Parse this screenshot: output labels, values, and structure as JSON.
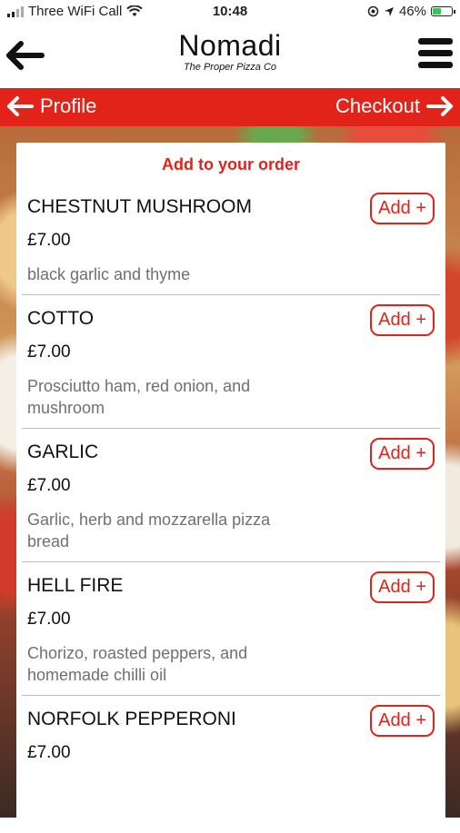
{
  "status": {
    "carrier": "Three WiFi Call",
    "time": "10:48",
    "battery": "46%",
    "battery_level": 0.46
  },
  "header": {
    "brand": "Nomadi",
    "tagline": "The Proper Pizza Co"
  },
  "nav": {
    "back_label": "Profile",
    "forward_label": "Checkout"
  },
  "menu": {
    "title": "Add to your order",
    "add_label": "Add +",
    "items": [
      {
        "name": "CHESTNUT MUSHROOM",
        "price": "£7.00",
        "description": "black garlic and thyme"
      },
      {
        "name": "COTTO",
        "price": "£7.00",
        "description": "Prosciutto ham, red onion, and mushroom"
      },
      {
        "name": "GARLIC",
        "price": "£7.00",
        "description": "Garlic, herb and mozzarella pizza bread"
      },
      {
        "name": "HELL FIRE",
        "price": "£7.00",
        "description": "Chorizo, roasted peppers, and homemade chilli oil"
      },
      {
        "name": "NORFOLK PEPPERONI",
        "price": "£7.00",
        "description": ""
      }
    ]
  },
  "colors": {
    "accent": "#e2231a",
    "text": "#111111",
    "muted": "#707070"
  },
  "icons": [
    "wifi-icon",
    "location-icon",
    "arrow-icon",
    "battery-icon",
    "back-arrow-icon",
    "menu-icon",
    "arrow-left-icon",
    "arrow-right-icon"
  ]
}
